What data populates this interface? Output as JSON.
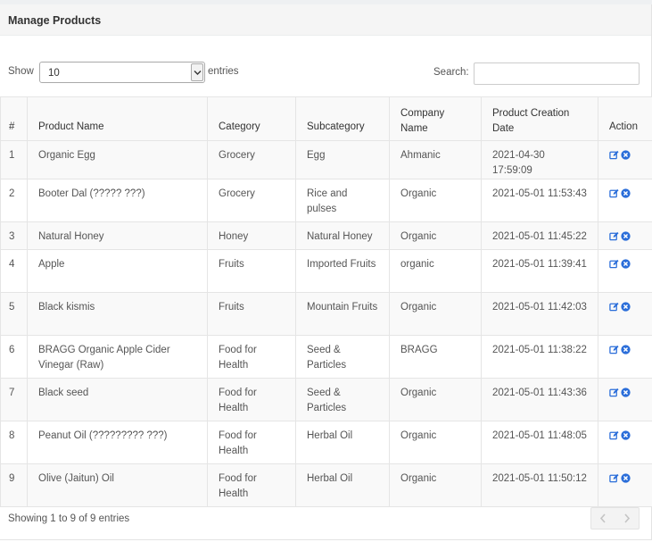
{
  "panel": {
    "title": "Manage Products"
  },
  "length": {
    "show_label": "Show",
    "selected": "10",
    "entries_label": "entries"
  },
  "search": {
    "label": "Search:",
    "value": "",
    "placeholder": ""
  },
  "table": {
    "headers": {
      "index": "#",
      "name": "Product Name",
      "category": "Category",
      "subcategory": "Subcategory",
      "company": "Company Name",
      "created": "Product Creation Date",
      "action": "Action"
    },
    "rows": [
      {
        "index": "1",
        "name": "Organic Egg",
        "category": "Grocery",
        "subcategory": "Egg",
        "company": "Ahmanic",
        "created": "2021-04-30 17:59:09"
      },
      {
        "index": "2",
        "name": "Booter Dal (????? ???)",
        "category": "Grocery",
        "subcategory": "Rice and pulses",
        "company": "Organic",
        "created": "2021-05-01 11:53:43"
      },
      {
        "index": "3",
        "name": "Natural Honey",
        "category": "Honey",
        "subcategory": "Natural Honey",
        "company": "Organic",
        "created": "2021-05-01 11:45:22"
      },
      {
        "index": "4",
        "name": "Apple",
        "category": "Fruits",
        "subcategory": "Imported Fruits",
        "company": "organic",
        "created": "2021-05-01 11:39:41"
      },
      {
        "index": "5",
        "name": "Black kismis",
        "category": "Fruits",
        "subcategory": "Mountain Fruits",
        "company": "Organic",
        "created": "2021-05-01 11:42:03"
      },
      {
        "index": "6",
        "name": "BRAGG Organic Apple Cider Vinegar (Raw)",
        "category": "Food for Health",
        "subcategory": "Seed & Particles",
        "company": "BRAGG",
        "created": "2021-05-01 11:38:22"
      },
      {
        "index": "7",
        "name": "Black seed",
        "category": "Food for Health",
        "subcategory": "Seed & Particles",
        "company": "Organic",
        "created": "2021-05-01 11:43:36"
      },
      {
        "index": "8",
        "name": "Peanut Oil (????????? ???)",
        "category": "Food for Health",
        "subcategory": "Herbal Oil",
        "company": "Organic",
        "created": "2021-05-01 11:48:05"
      },
      {
        "index": "9",
        "name": "Olive (Jaitun) Oil",
        "category": "Food for Health",
        "subcategory": "Herbal Oil",
        "company": "Organic",
        "created": "2021-05-01 11:50:12"
      }
    ]
  },
  "info": {
    "text": "Showing 1 to 9 of 9 entries"
  },
  "icons": {
    "edit": "edit-icon",
    "delete": "delete-icon",
    "prev": "chevron-left-icon",
    "next": "chevron-right-icon",
    "dropdown": "chevron-down-icon"
  },
  "colors": {
    "action_blue": "#2a6dd9",
    "pager_disabled": "#c4c4c4"
  }
}
